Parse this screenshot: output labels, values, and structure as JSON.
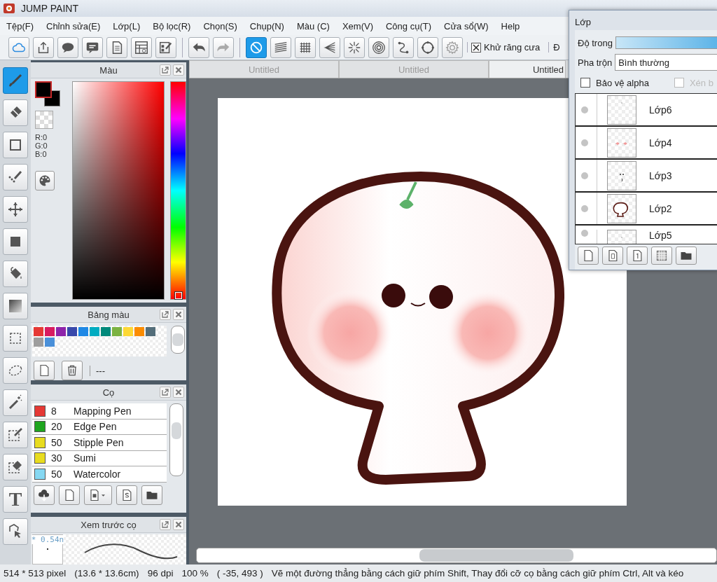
{
  "window": {
    "title": "JUMP PAINT"
  },
  "menu": [
    "Tệp(F)",
    "Chỉnh sửa(E)",
    "Lớp(L)",
    "Bộ lọc(R)",
    "Chọn(S)",
    "Chụp(N)",
    "Màu (C)",
    "Xem(V)",
    "Công cụ(T)",
    "Cửa sổ(W)",
    "Help"
  ],
  "toolbar": {
    "groups": [
      [
        {
          "kind": "cloud",
          "selected": false
        },
        {
          "kind": "share",
          "selected": false
        },
        {
          "kind": "speech",
          "selected": false
        },
        {
          "kind": "message",
          "selected": false
        },
        {
          "kind": "document",
          "selected": false
        },
        {
          "kind": "layout",
          "selected": false
        },
        {
          "kind": "checklist",
          "selected": false
        }
      ],
      [
        {
          "kind": "undo",
          "selected": false
        },
        {
          "kind": "redo",
          "selected": false
        }
      ],
      [
        {
          "kind": "prohibit",
          "selected": true
        },
        {
          "kind": "parallel",
          "selected": false
        },
        {
          "kind": "grid",
          "selected": false
        },
        {
          "kind": "converging",
          "selected": false
        },
        {
          "kind": "starburst",
          "selected": false
        },
        {
          "kind": "concentric",
          "selected": false
        },
        {
          "kind": "curve",
          "selected": false
        },
        {
          "kind": "circle",
          "selected": false
        },
        {
          "kind": "gear",
          "selected": false
        }
      ]
    ],
    "antialias": {
      "label": "Khử răng cưa",
      "checked": true
    },
    "cut_label": "Đ"
  },
  "tools": [
    {
      "kind": "brush",
      "selected": true
    },
    {
      "kind": "eraser",
      "selected": false
    },
    {
      "kind": "rect",
      "selected": false
    },
    {
      "kind": "dotpen",
      "selected": false
    },
    {
      "kind": "move",
      "selected": false
    },
    {
      "kind": "fillrect",
      "selected": false
    },
    {
      "kind": "bucket",
      "selected": false
    },
    {
      "kind": "gradient",
      "selected": false
    },
    {
      "kind": "select",
      "selected": false
    },
    {
      "kind": "lasso",
      "selected": false
    },
    {
      "kind": "wand",
      "selected": false
    },
    {
      "kind": "selpen",
      "selected": false
    },
    {
      "kind": "selerase",
      "selected": false
    },
    {
      "kind": "text",
      "label": "T",
      "selected": false
    },
    {
      "kind": "shapeselect",
      "selected": false
    }
  ],
  "color_panel": {
    "title": "Màu",
    "rgb": [
      "R:0",
      "G:0",
      "B:0"
    ],
    "hue": {
      "level": 0
    }
  },
  "palette_panel": {
    "title": "Bảng màu",
    "swatches": [
      {
        "color": "#e53935"
      },
      {
        "color": "#d81b60"
      },
      {
        "color": "#8e24aa"
      },
      {
        "color": "#3949ab"
      },
      {
        "color": "#1e88e5"
      },
      {
        "color": "#00acc1"
      },
      {
        "color": "#00897b"
      },
      {
        "color": "#7cb342"
      },
      {
        "color": "#fdd835"
      },
      {
        "color": "#fb8c00"
      },
      {
        "color": "#546e7a"
      },
      {
        "color": "#9e9e9e"
      },
      {
        "color": "#4a90d9"
      }
    ],
    "current": "---"
  },
  "brush_panel": {
    "title": "Cọ",
    "brushes": [
      {
        "color": "#e53935",
        "size": "8",
        "name": "Mapping Pen"
      },
      {
        "color": "#1fa51f",
        "size": "20",
        "name": "Edge Pen"
      },
      {
        "color": "#e8dc1f",
        "size": "50",
        "name": "Stipple Pen"
      },
      {
        "color": "#e8dc1f",
        "size": "30",
        "name": "Sumi"
      },
      {
        "color": "#86d8f2",
        "size": "50",
        "name": "Watercolor"
      }
    ]
  },
  "preview_panel": {
    "title": "Xem trước cọ",
    "size": "* 0.54n"
  },
  "document_tabs": [
    {
      "label": "Untitled",
      "selected": false
    },
    {
      "label": "Untitled",
      "selected": false
    },
    {
      "label": "Untitled",
      "selected": true
    }
  ],
  "layer_window": {
    "title": "Lớp",
    "opacity": {
      "label": "Độ trong",
      "level": 1
    },
    "blend": {
      "label": "Pha trộn",
      "value": "Bình thường"
    },
    "protect_alpha": {
      "label": "Bảo vệ alpha",
      "checked": false
    },
    "clip": {
      "label": "Xén b",
      "checked": false,
      "disabled": true
    },
    "layers": [
      {
        "name": "Lớp6",
        "kind": "blank"
      },
      {
        "name": "Lớp4",
        "kind": "cheeks"
      },
      {
        "name": "Lớp3",
        "kind": "face"
      },
      {
        "name": "Lớp2",
        "kind": "outline"
      },
      {
        "name": "Lớp5",
        "kind": "blank"
      }
    ]
  },
  "status_bar": {
    "size": "514 * 513 pixel",
    "physical": "(13.6 * 13.6cm)",
    "dpi": "96 dpi",
    "zoom": "100 %",
    "cursor": "( -35, 493 )",
    "hint": "Vẽ một đường thẳng bằng cách giữ phím Shift, Thay đổi cỡ cọ bằng cách giữ phím Ctrl, Alt và kéo"
  }
}
